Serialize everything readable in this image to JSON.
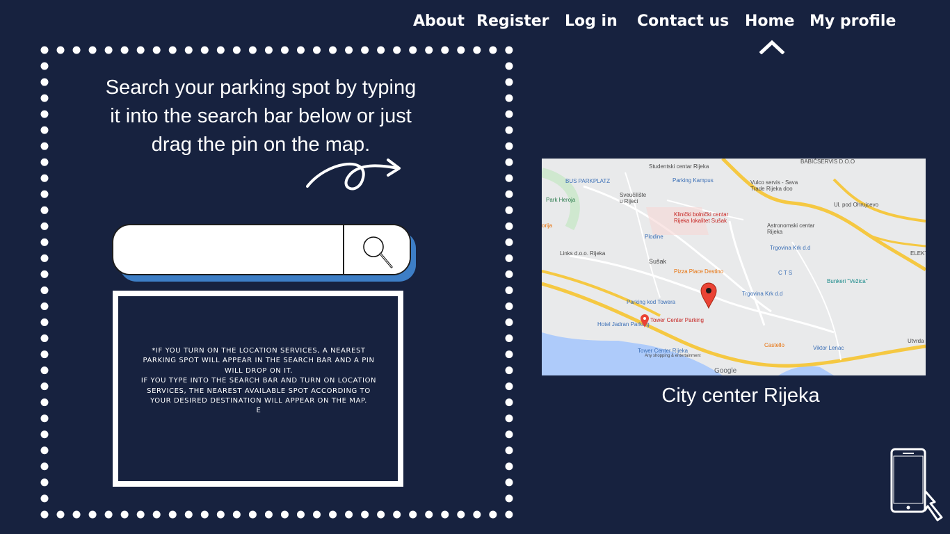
{
  "nav": {
    "items": [
      {
        "label": "About"
      },
      {
        "label": "Register"
      },
      {
        "label": "Log in"
      },
      {
        "label": "Contact us"
      },
      {
        "label": "Home",
        "active": true
      },
      {
        "label": "My  profile"
      }
    ]
  },
  "search": {
    "heading": "Search your parking spot by typing it into the search bar below or just drag the pin on the map.",
    "value": "",
    "placeholder": ""
  },
  "info": {
    "lines": [
      "*IF YOU TURN ON THE LOCATION SERVICES, A NEAREST PARKING SPOT WILL APPEAR IN THE SEARCH BAR AND A PIN WILL DROP ON IT.",
      "IF YOU TYPE INTO THE SEARCH BAR AND TURN ON LOCATION SERVICES, THE NEAREST AVAILABLE SPOT ACCORDING TO YOUR DESIRED DESTINATION WILL APPEAR ON THE MAP.",
      "E"
    ]
  },
  "map": {
    "caption": "City center Rijeka",
    "labels": {
      "babicservis": "BABIČSERVIS D.O.O",
      "studentski": "Studentski centar Rijeka",
      "parking_kampus": "Parking Kampus",
      "bus_parkplatz": "BUS PARKPLATZ",
      "sveuciliste": "Sveučilište u Rijeci",
      "park_heroja": "Park Heroja",
      "vulco": "Vulco servis - Sava Trade Rijeka doo",
      "ul_ohrupcevo": "Ul. pod Ohrujcevo",
      "klinicki": "Klinički bolnički centar Rijeka lokalitet Sušak",
      "astronomski": "Astronomski centar Rijeka",
      "plodine": "Plodine",
      "trgovina1": "Trgovina Krk d.d",
      "links": "Links d.o.o. Rijeka",
      "susak": "Sušak",
      "pizza": "Pizza Place Destino",
      "cts": "C T S",
      "bunkeri": "Bunkeri \"Vežica\"",
      "trgovina2": "Trgovina Krk d.d",
      "parking_towera": "Parking kod Towera",
      "tower_parking": "Tower Center Parking",
      "jadran": "Hotel Jadran Parking",
      "castello": "Castello",
      "viktor": "Viktor Lenac",
      "tower_center": "Tower Center Rijeka",
      "tower_sub": "Any shopping & entertainment",
      "utvrda": "Utvrda",
      "elektr": "ELEKTR",
      "google": "Google",
      "orija": "orija"
    },
    "colors": {
      "water": "#aecbfa",
      "road_major": "#f5c842",
      "pin": "#ea4335"
    }
  },
  "icons": {
    "search": "magnifier-icon",
    "home_indicator": "chevron-up-icon",
    "phone": "smartphone-tap-icon",
    "map_pin": "map-pin-icon"
  },
  "colors": {
    "background": "#17223f",
    "search_shadow": "#3d7ec6",
    "text": "#ffffff"
  }
}
